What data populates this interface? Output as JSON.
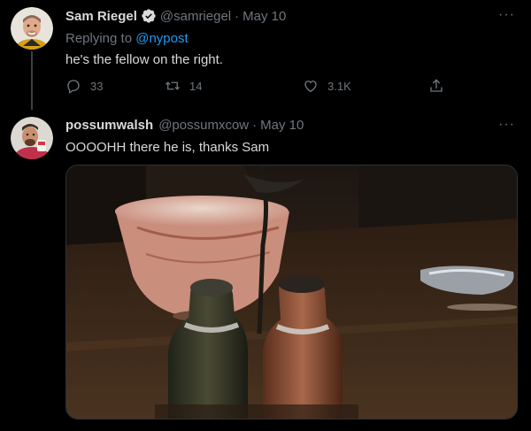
{
  "tweet1": {
    "name": "Sam Riegel",
    "handle": "@samriegel",
    "separator": "·",
    "date": "May 10",
    "replying_prefix": "Replying to ",
    "replying_to": "@nypost",
    "text": "he's the fellow on the right.",
    "more": "···",
    "actions": {
      "reply_count": "33",
      "retweet_count": "14",
      "like_count": "3.1K"
    },
    "icons": [
      "reply-icon",
      "retweet-icon",
      "like-icon",
      "share-icon",
      "verified-icon",
      "more-icon"
    ]
  },
  "tweet2": {
    "name": "possumwalsh",
    "handle": "@possumxcow",
    "separator": "·",
    "date": "May 10",
    "text": "OOOOHH there he is, thanks Sam",
    "more": "···"
  },
  "colors": {
    "background": "#000000",
    "primary_text": "#d9d9d9",
    "secondary_text": "#6e767d",
    "accent": "#1d9bf0"
  }
}
